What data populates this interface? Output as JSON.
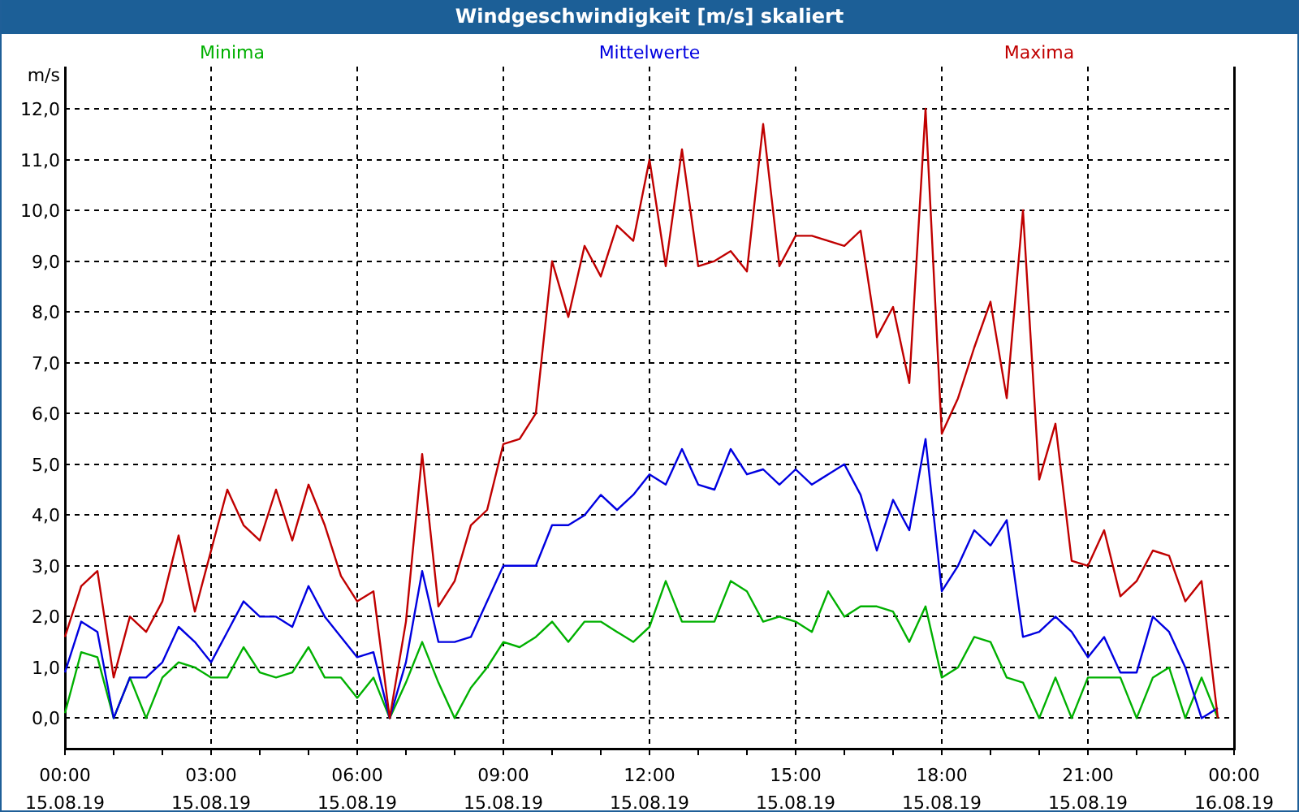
{
  "window": {
    "title": "Windgeschwindigkeit [m/s] skaliert"
  },
  "chart": {
    "chart_data": {
      "type": "line",
      "grid": true,
      "ylabel": "m/s",
      "ylim": [
        -0.6,
        12
      ],
      "categories": [
        "00:00\n15.08.19",
        null,
        null,
        null,
        null,
        null,
        null,
        null,
        null,
        "03:00\n15.08.19",
        null,
        null,
        null,
        null,
        null,
        null,
        null,
        null,
        "06:00\n15.08.19",
        null,
        null,
        null,
        null,
        null,
        null,
        null,
        null,
        "09:00\n15.08.19",
        null,
        null,
        null,
        null,
        null,
        null,
        null,
        null,
        "12:00\n15.08.19",
        null,
        null,
        null,
        null,
        null,
        null,
        null,
        null,
        "15:00\n15.08.19",
        null,
        null,
        null,
        null,
        null,
        null,
        null,
        null,
        "18:00\n15.08.19",
        null,
        null,
        null,
        null,
        null,
        null,
        null,
        null,
        "21:00\n15.08.19",
        null,
        null,
        null,
        null,
        null,
        null,
        null,
        null,
        "00:00\n16.08.19"
      ],
      "yticks": [
        {
          "value": 0,
          "label": "0,0"
        },
        {
          "value": 1,
          "label": "1,0"
        },
        {
          "value": 2,
          "label": "2,0"
        },
        {
          "value": 3,
          "label": "3,0"
        },
        {
          "value": 4,
          "label": "4,0"
        },
        {
          "value": 5,
          "label": "5,0"
        },
        {
          "value": 6,
          "label": "6,0"
        },
        {
          "value": 7,
          "label": "7,0"
        },
        {
          "value": 8,
          "label": "8,0"
        },
        {
          "value": 9,
          "label": "9,0"
        },
        {
          "value": 10,
          "label": "10,0"
        },
        {
          "value": 11,
          "label": "11,0"
        },
        {
          "value": 12,
          "label": "12,0"
        }
      ],
      "series": [
        {
          "name": "Minima",
          "color": "#00b000",
          "values": [
            0.1,
            1.3,
            1.2,
            0.0,
            0.8,
            0.0,
            0.8,
            1.1,
            1.0,
            0.8,
            0.8,
            1.4,
            0.9,
            0.8,
            0.9,
            1.4,
            0.8,
            0.8,
            0.4,
            0.8,
            0.0,
            0.7,
            1.5,
            0.7,
            0.0,
            0.6,
            1.0,
            1.5,
            1.4,
            1.6,
            1.9,
            1.5,
            1.9,
            1.9,
            1.7,
            1.5,
            1.8,
            2.7,
            1.9,
            1.9,
            1.9,
            2.7,
            2.5,
            1.9,
            2.0,
            1.9,
            1.7,
            2.5,
            2.0,
            2.2,
            2.2,
            2.1,
            1.5,
            2.2,
            0.8,
            1.0,
            1.6,
            1.5,
            0.8,
            0.7,
            0.0,
            0.8,
            0.0,
            0.8,
            0.8,
            0.8,
            0.0,
            0.8,
            1.0,
            0.0,
            0.8,
            0.0,
            null
          ]
        },
        {
          "name": "Mittelwerte",
          "color": "#0000e0",
          "values": [
            0.9,
            1.9,
            1.7,
            0.0,
            0.8,
            0.8,
            1.1,
            1.8,
            1.5,
            1.1,
            1.7,
            2.3,
            2.0,
            2.0,
            1.8,
            2.6,
            2.0,
            1.6,
            1.2,
            1.3,
            0.0,
            1.1,
            2.9,
            1.5,
            1.5,
            1.6,
            2.3,
            3.0,
            3.0,
            3.0,
            3.8,
            3.8,
            4.0,
            4.4,
            4.1,
            4.4,
            4.8,
            4.6,
            5.3,
            4.6,
            4.5,
            5.3,
            4.8,
            4.9,
            4.6,
            4.9,
            4.6,
            4.8,
            5.0,
            4.4,
            3.3,
            4.3,
            3.7,
            5.5,
            2.5,
            3.0,
            3.7,
            3.4,
            3.9,
            1.6,
            1.7,
            2.0,
            1.7,
            1.2,
            1.6,
            0.9,
            0.9,
            2.0,
            1.7,
            1.0,
            0.0,
            0.2,
            null
          ]
        },
        {
          "name": "Maxima",
          "color": "#c00000",
          "values": [
            1.6,
            2.6,
            2.9,
            0.8,
            2.0,
            1.7,
            2.3,
            3.6,
            2.1,
            3.3,
            4.5,
            3.8,
            3.5,
            4.5,
            3.5,
            4.6,
            3.8,
            2.8,
            2.3,
            2.5,
            0.0,
            1.9,
            5.2,
            2.2,
            2.7,
            3.8,
            4.1,
            5.4,
            5.5,
            6.0,
            9.0,
            7.9,
            9.3,
            8.7,
            9.7,
            9.4,
            11.0,
            8.9,
            11.2,
            8.9,
            9.0,
            9.2,
            8.8,
            11.7,
            8.9,
            9.5,
            9.5,
            9.4,
            9.3,
            9.6,
            7.5,
            8.1,
            6.6,
            12.0,
            5.6,
            6.3,
            7.3,
            8.2,
            6.3,
            10.0,
            4.7,
            5.8,
            3.1,
            3.0,
            3.7,
            2.4,
            2.7,
            3.3,
            3.2,
            2.3,
            2.7,
            0.0,
            null
          ]
        }
      ]
    }
  }
}
